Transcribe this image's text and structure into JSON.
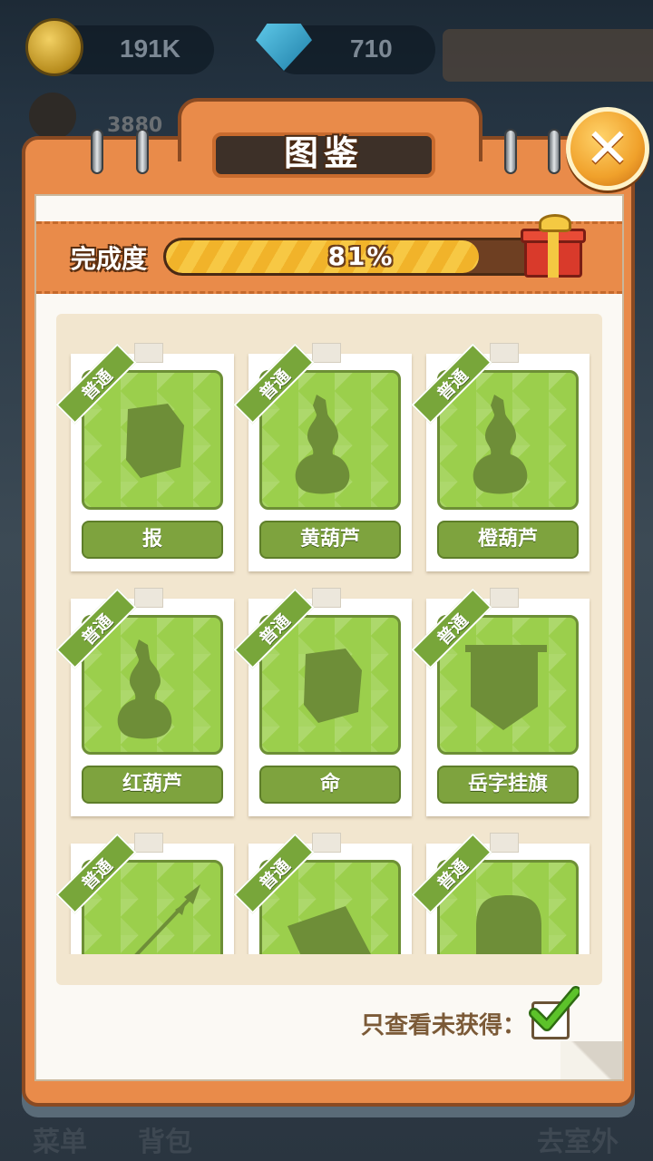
{
  "hud": {
    "coins": "191K",
    "gems": "710",
    "score": "3880",
    "coin_icon": "gold-coin-icon",
    "gem_icon": "diamond-icon"
  },
  "dialog": {
    "title": "图鉴",
    "close_icon": "close-x-icon"
  },
  "progress": {
    "label": "完成度",
    "value_text": "81%",
    "fraction": 0.81,
    "reward_icon": "gift-box-icon"
  },
  "cards": [
    {
      "rarity": "普通",
      "name": "报",
      "silhouette": "stone-block"
    },
    {
      "rarity": "普通",
      "name": "黄葫芦",
      "silhouette": "gourd"
    },
    {
      "rarity": "普通",
      "name": "橙葫芦",
      "silhouette": "gourd"
    },
    {
      "rarity": "普通",
      "name": "红葫芦",
      "silhouette": "gourd"
    },
    {
      "rarity": "普通",
      "name": "命",
      "silhouette": "stone-block"
    },
    {
      "rarity": "普通",
      "name": "岳字挂旗",
      "silhouette": "banner"
    },
    {
      "rarity": "普通",
      "name": "",
      "silhouette": "spear"
    },
    {
      "rarity": "普通",
      "name": "",
      "silhouette": "plank"
    },
    {
      "rarity": "普通",
      "name": "",
      "silhouette": "tombstone"
    }
  ],
  "filter": {
    "label": "只查看未获得：",
    "checked": true
  },
  "bottom_nav": {
    "menu": "菜单",
    "bag": "背包",
    "outdoor": "去室外"
  },
  "colors": {
    "book_orange": "#e98b4a",
    "card_green": "#9bcf4c",
    "plate_green": "#7ea33e",
    "progress_yellow": "#f7c844"
  }
}
